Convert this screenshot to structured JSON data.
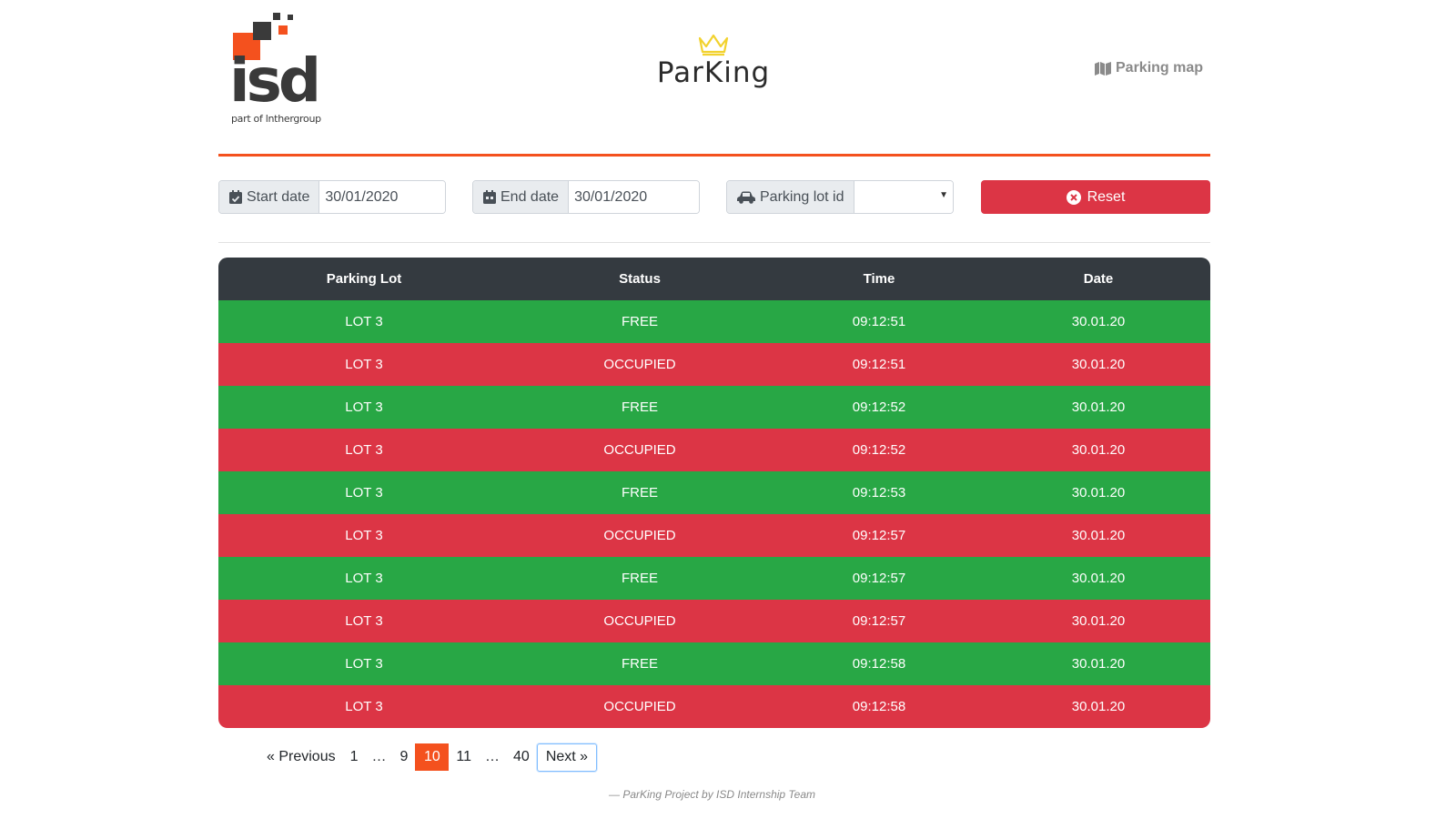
{
  "header": {
    "logo_text": "isd",
    "logo_subtitle": "part of lnthergroup",
    "brand_name": "ParKing",
    "nav_link": "Parking map",
    "colors": {
      "accent": "#f4511e",
      "crown": "#f2d22e",
      "logo_dark": "#3a3a3a"
    }
  },
  "filters": {
    "start_date": {
      "label": "Start date",
      "value": "30/01/2020",
      "icon": "calendar-icon"
    },
    "end_date": {
      "label": "End date",
      "value": "30/01/2020",
      "icon": "calendar-icon"
    },
    "parking_lot": {
      "label": "Parking lot id",
      "value": "",
      "icon": "car-icon"
    },
    "reset_label": "Reset"
  },
  "table": {
    "headers": [
      "Parking Lot",
      "Status",
      "Time",
      "Date"
    ],
    "rows": [
      {
        "lot": "LOT 3",
        "status": "FREE",
        "time": "09:12:51",
        "date": "30.01.20"
      },
      {
        "lot": "LOT 3",
        "status": "OCCUPIED",
        "time": "09:12:51",
        "date": "30.01.20"
      },
      {
        "lot": "LOT 3",
        "status": "FREE",
        "time": "09:12:52",
        "date": "30.01.20"
      },
      {
        "lot": "LOT 3",
        "status": "OCCUPIED",
        "time": "09:12:52",
        "date": "30.01.20"
      },
      {
        "lot": "LOT 3",
        "status": "FREE",
        "time": "09:12:53",
        "date": "30.01.20"
      },
      {
        "lot": "LOT 3",
        "status": "OCCUPIED",
        "time": "09:12:57",
        "date": "30.01.20"
      },
      {
        "lot": "LOT 3",
        "status": "FREE",
        "time": "09:12:57",
        "date": "30.01.20"
      },
      {
        "lot": "LOT 3",
        "status": "OCCUPIED",
        "time": "09:12:57",
        "date": "30.01.20"
      },
      {
        "lot": "LOT 3",
        "status": "FREE",
        "time": "09:12:58",
        "date": "30.01.20"
      },
      {
        "lot": "LOT 3",
        "status": "OCCUPIED",
        "time": "09:12:58",
        "date": "30.01.20"
      }
    ],
    "colors": {
      "free": "#28a745",
      "occupied": "#dc3545",
      "header": "#343a40"
    }
  },
  "pagination": {
    "previous": "« Previous",
    "pages": [
      "1",
      "…",
      "9",
      "10",
      "11",
      "…",
      "40"
    ],
    "current": "10",
    "next": "Next »"
  },
  "footer": "— ParKing Project by ISD Internship Team"
}
